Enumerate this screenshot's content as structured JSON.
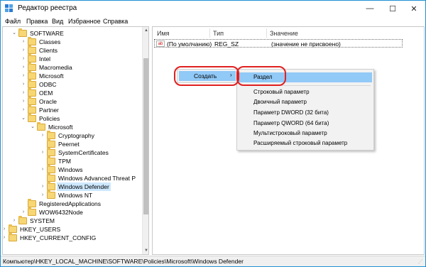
{
  "window": {
    "title": "Редактор реестра",
    "accent": "#1e8fd6",
    "controls": {
      "minimize": "—",
      "maximize": "☐",
      "close": "✕"
    }
  },
  "menu": [
    "Файл",
    "Правка",
    "Вид",
    "Избранное",
    "Справка"
  ],
  "tree": [
    {
      "label": "SOFTWARE",
      "level": 0,
      "arrow": "expanded"
    },
    {
      "label": "Classes",
      "level": 1,
      "arrow": "collapsed"
    },
    {
      "label": "Clients",
      "level": 1,
      "arrow": "collapsed"
    },
    {
      "label": "Intel",
      "level": 1,
      "arrow": "collapsed"
    },
    {
      "label": "Macromedia",
      "level": 1,
      "arrow": "collapsed"
    },
    {
      "label": "Microsoft",
      "level": 1,
      "arrow": "collapsed"
    },
    {
      "label": "ODBC",
      "level": 1,
      "arrow": "collapsed"
    },
    {
      "label": "OEM",
      "level": 1,
      "arrow": "collapsed"
    },
    {
      "label": "Oracle",
      "level": 1,
      "arrow": "collapsed"
    },
    {
      "label": "Partner",
      "level": 1,
      "arrow": "collapsed"
    },
    {
      "label": "Policies",
      "level": 1,
      "arrow": "expanded"
    },
    {
      "label": "Microsoft",
      "level": 2,
      "arrow": "expanded"
    },
    {
      "label": "Cryptography",
      "level": 3,
      "arrow": "collapsed"
    },
    {
      "label": "Peernet",
      "level": 3,
      "arrow": "none"
    },
    {
      "label": "SystemCertificates",
      "level": 3,
      "arrow": "collapsed"
    },
    {
      "label": "TPM",
      "level": 3,
      "arrow": "none"
    },
    {
      "label": "Windows",
      "level": 3,
      "arrow": "collapsed"
    },
    {
      "label": "Windows Advanced Threat P",
      "level": 3,
      "arrow": "none"
    },
    {
      "label": "Windows Defender",
      "level": 3,
      "arrow": "collapsed",
      "selected": true
    },
    {
      "label": "Windows NT",
      "level": 3,
      "arrow": "collapsed"
    },
    {
      "label": "RegisteredApplications",
      "level": 1,
      "arrow": "none"
    },
    {
      "label": "WOW6432Node",
      "level": 1,
      "arrow": "collapsed"
    },
    {
      "label": "SYSTEM",
      "level": 0,
      "arrow": "collapsed"
    },
    {
      "label": "HKEY_USERS",
      "level": -1,
      "arrow": "collapsed"
    },
    {
      "label": "HKEY_CURRENT_CONFIG",
      "level": -1,
      "arrow": "collapsed"
    }
  ],
  "list": {
    "columns": {
      "name": "Имя",
      "type": "Тип",
      "value": "Значение"
    },
    "rows": [
      {
        "icon": "ab",
        "name": "(По умолчанию)",
        "type": "REG_SZ",
        "value": "(значение не присвоено)"
      }
    ]
  },
  "context_menu": {
    "create_label": "Создать",
    "submenu_arrow": "›",
    "submenu": [
      "Раздел",
      "Строковый параметр",
      "Двоичный параметр",
      "Параметр DWORD (32 бита)",
      "Параметр QWORD (64 бита)",
      "Мультистроковый параметр",
      "Расширяемый строковый параметр"
    ]
  },
  "status": {
    "path": "Компьютер\\HKEY_LOCAL_MACHINE\\SOFTWARE\\Policies\\Microsoft\\Windows Defender"
  }
}
